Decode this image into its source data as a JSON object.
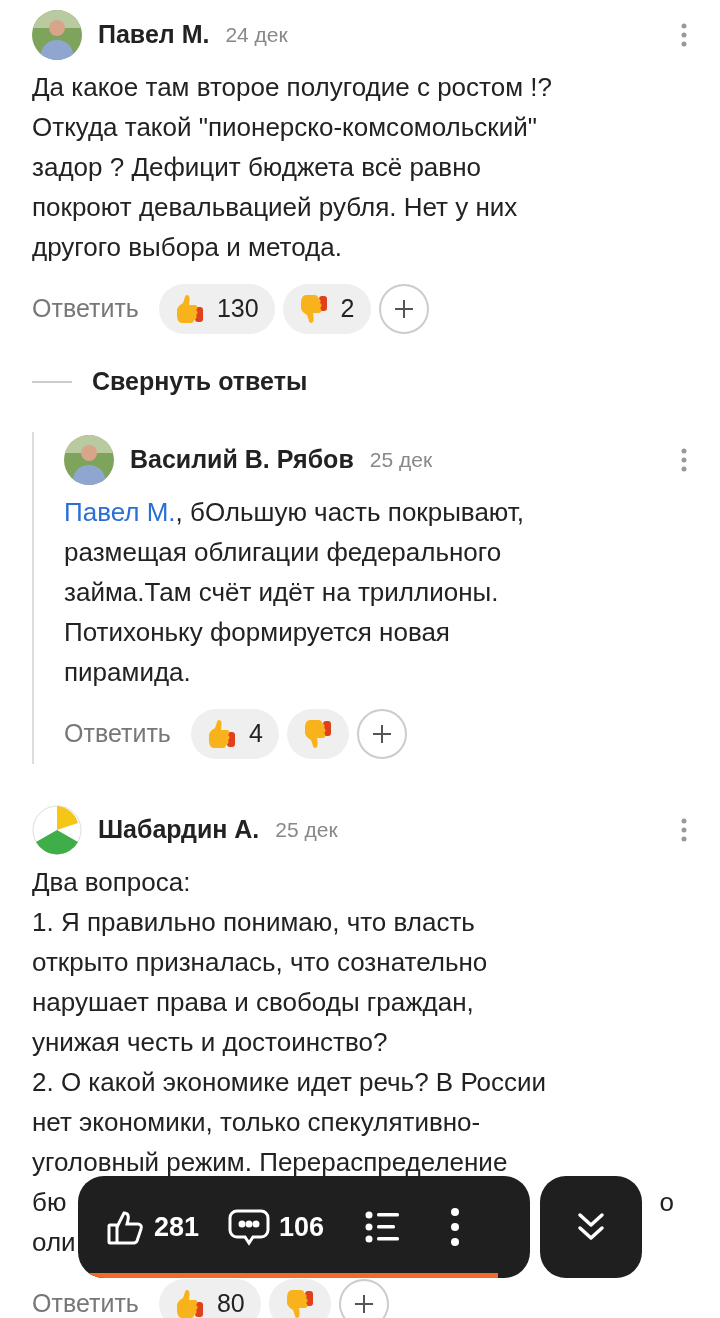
{
  "comments": [
    {
      "author": "Павел М.",
      "date": "24 дек",
      "avatar": {
        "kind": "picture"
      },
      "lines": [
        "Да какое там второе полугодие с ростом !?",
        "Откуда такой \"пионерско-комсомольский\"",
        "задор ? Дефицит бюджета всё равно",
        "покроют девальвацией рубля. Нет у них",
        "другого выбора и метода."
      ],
      "reply": "Ответить",
      "likes": "130",
      "dislikes": "2",
      "collapse": "Свернуть ответы",
      "replies": [
        {
          "author": "Василий В. Рябов",
          "date": "25 дек",
          "avatar": {
            "kind": "picture"
          },
          "mention": "Павел М.",
          "lines": [
            ", бОльшую часть покрывают,",
            "размещая облигации федерального",
            "займа.Там счёт идёт на триллионы.",
            "Потихоньку формируется новая",
            "пирамида."
          ],
          "reply": "Ответить",
          "likes": "4"
        }
      ]
    },
    {
      "author": "Шабардин А.",
      "date": "25 дек",
      "avatar": {
        "kind": "logo"
      },
      "lines": [
        "Два вопроса:",
        "1. Я правильно понимаю, что власть",
        "открыто призналась, что сознательно",
        "нарушает права и свободы граждан,",
        "унижая честь и достоинство?",
        "2. О какой экономике идет речь? В России",
        "нет экономики, только спекулятивно-",
        "уголовный режим. Перераспределение"
      ],
      "covered_lines": [
        {
          "left": "бю",
          "right": "о"
        },
        {
          "left": "оли"
        }
      ],
      "reply": "Ответить",
      "likes": "80"
    }
  ],
  "toolbar": {
    "likes": "281",
    "comments": "106"
  }
}
